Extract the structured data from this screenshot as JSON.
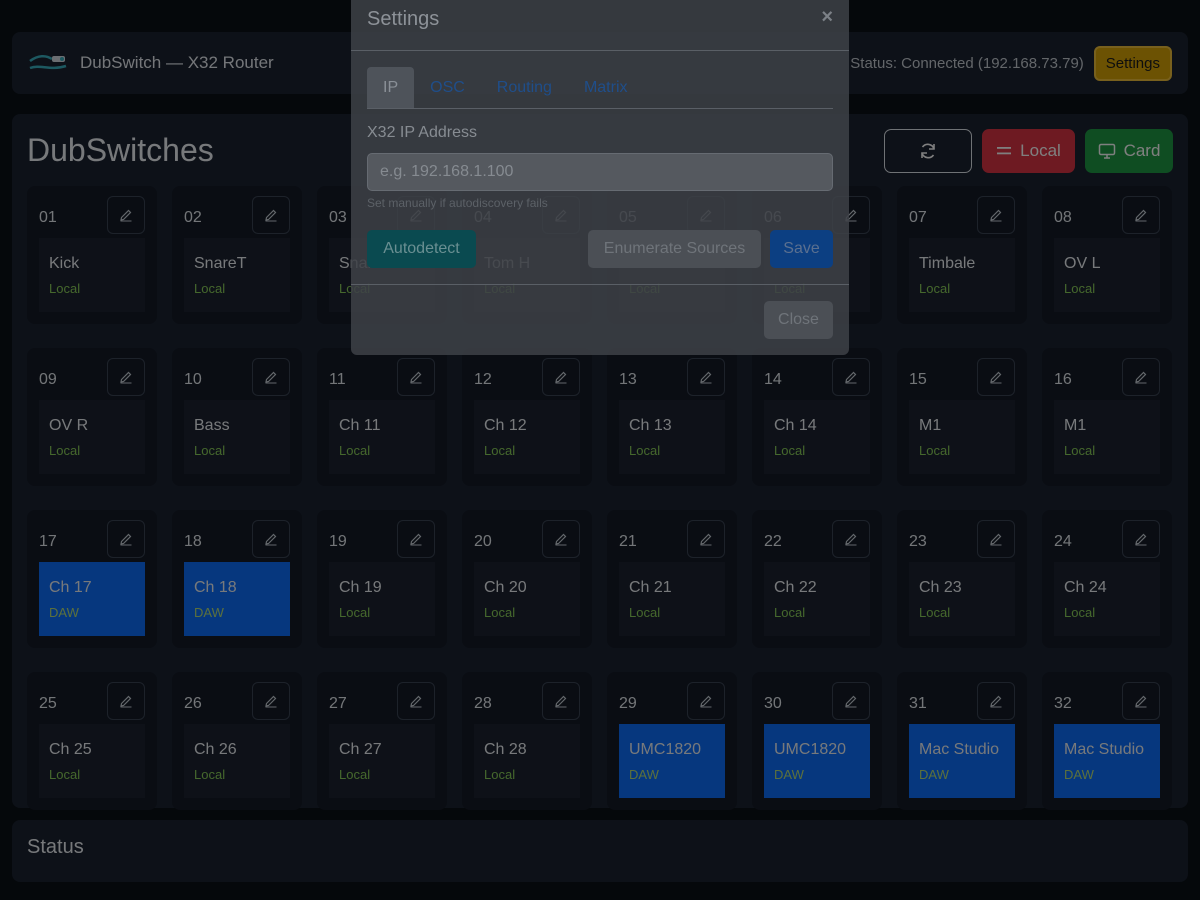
{
  "header": {
    "title": "DubSwitch — X32 Router",
    "status": "Status: Connected (192.168.73.79)",
    "settings_label": "Settings"
  },
  "main": {
    "title": "DubSwitches",
    "local_label": "Local",
    "card_label": "Card"
  },
  "switches": [
    {
      "num": "01",
      "name": "Kick",
      "route": "Local"
    },
    {
      "num": "02",
      "name": "SnareT",
      "route": "Local"
    },
    {
      "num": "03",
      "name": "Snare B",
      "route": "Local"
    },
    {
      "num": "04",
      "name": "Tom H",
      "route": "Local"
    },
    {
      "num": "05",
      "name": "Tom M",
      "route": "Local"
    },
    {
      "num": "06",
      "name": "Tom L",
      "route": "Local"
    },
    {
      "num": "07",
      "name": "Timbale",
      "route": "Local"
    },
    {
      "num": "08",
      "name": "OV L",
      "route": "Local"
    },
    {
      "num": "09",
      "name": "OV R",
      "route": "Local"
    },
    {
      "num": "10",
      "name": "Bass",
      "route": "Local"
    },
    {
      "num": "11",
      "name": "Ch 11",
      "route": "Local"
    },
    {
      "num": "12",
      "name": "Ch 12",
      "route": "Local"
    },
    {
      "num": "13",
      "name": "Ch 13",
      "route": "Local"
    },
    {
      "num": "14",
      "name": "Ch 14",
      "route": "Local"
    },
    {
      "num": "15",
      "name": "M1",
      "route": "Local"
    },
    {
      "num": "16",
      "name": "M1",
      "route": "Local"
    },
    {
      "num": "17",
      "name": "Ch 17",
      "route": "DAW"
    },
    {
      "num": "18",
      "name": "Ch 18",
      "route": "DAW"
    },
    {
      "num": "19",
      "name": "Ch 19",
      "route": "Local"
    },
    {
      "num": "20",
      "name": "Ch 20",
      "route": "Local"
    },
    {
      "num": "21",
      "name": "Ch 21",
      "route": "Local"
    },
    {
      "num": "22",
      "name": "Ch 22",
      "route": "Local"
    },
    {
      "num": "23",
      "name": "Ch 23",
      "route": "Local"
    },
    {
      "num": "24",
      "name": "Ch 24",
      "route": "Local"
    },
    {
      "num": "25",
      "name": "Ch 25",
      "route": "Local"
    },
    {
      "num": "26",
      "name": "Ch 26",
      "route": "Local"
    },
    {
      "num": "27",
      "name": "Ch 27",
      "route": "Local"
    },
    {
      "num": "28",
      "name": "Ch 28",
      "route": "Local"
    },
    {
      "num": "29",
      "name": "UMC1820",
      "route": "DAW"
    },
    {
      "num": "30",
      "name": "UMC1820",
      "route": "DAW"
    },
    {
      "num": "31",
      "name": "Mac Studio",
      "route": "DAW"
    },
    {
      "num": "32",
      "name": "Mac Studio",
      "route": "DAW"
    }
  ],
  "status_panel": {
    "title": "Status"
  },
  "modal": {
    "title": "Settings",
    "close_glyph": "×",
    "tabs": [
      "IP",
      "OSC",
      "Routing",
      "Matrix"
    ],
    "active_tab": "IP",
    "ip_label": "X32 IP Address",
    "ip_placeholder": "e.g. 192.168.1.100",
    "ip_value": "",
    "hint": "Set manually if autodiscovery fails",
    "autodetect_label": "Autodetect",
    "enumerate_label": "Enumerate Sources",
    "save_label": "Save",
    "close_label": "Close"
  },
  "colors": {
    "daw": "#0d6efd",
    "local_route_text": "#8bd05a",
    "settings_button": "#d9a406",
    "local_button": "#dc3545",
    "card_button": "#1f9b45"
  }
}
